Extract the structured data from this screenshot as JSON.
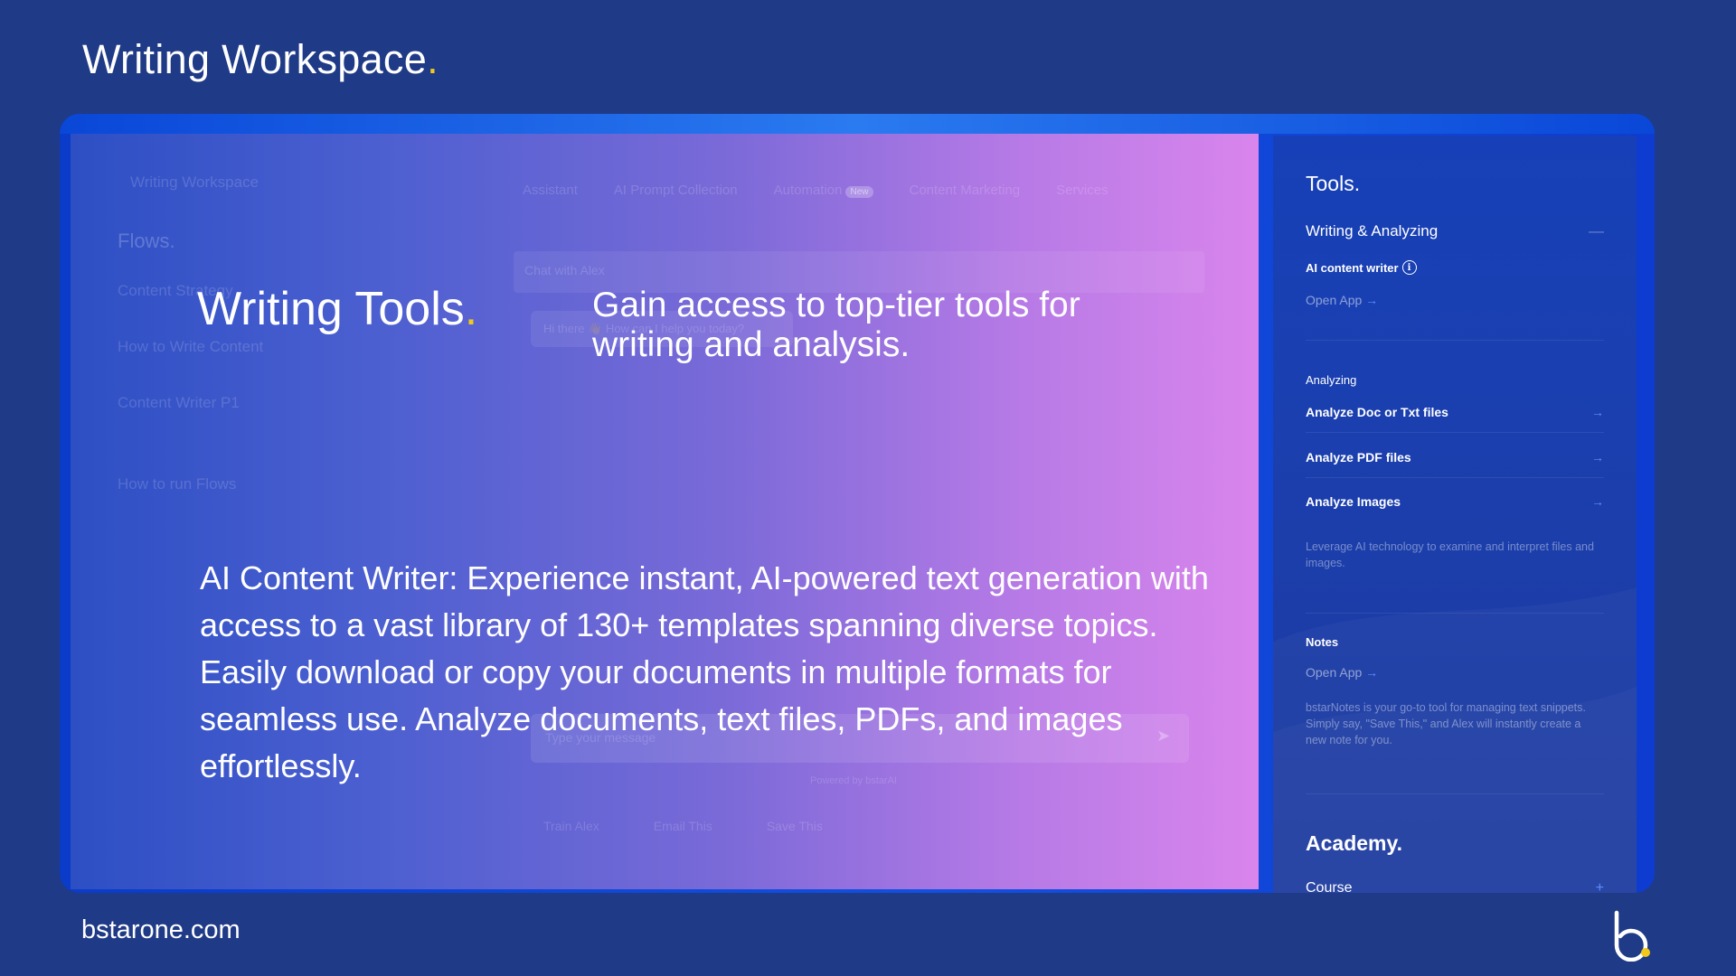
{
  "page": {
    "title": "Writing Workspace",
    "title_dot": ".",
    "footer_url": "bstarone.com",
    "accent_color": "#f2c919",
    "background_color": "#1f3a86"
  },
  "background_app": {
    "workspace_label": "Writing Workspace",
    "flows_heading": "Flows.",
    "flow_items": [
      "Content Strategy",
      "How to Write Content",
      "Content Writer P1",
      "How to run Flows"
    ],
    "tabs": [
      "Assistant",
      "AI Prompt Collection",
      "Automation",
      "Content Marketing",
      "Services"
    ],
    "new_badge": "New",
    "chat_label": "Chat with Alex",
    "greeting": "Hi there 👋 How can I help you today?",
    "input_placeholder": "Type your message",
    "powered_by": "Powered by bstarAI",
    "actions": [
      "Train Alex",
      "Email This",
      "Save This"
    ]
  },
  "overlay": {
    "title": "Writing Tools",
    "title_dot": ".",
    "tagline": "Gain access to top-tier tools for writing and analysis.",
    "description": "AI Content Writer: Experience instant, AI-powered text generation with access to a vast library of 130+ templates spanning diverse topics. Easily download or copy your documents in multiple formats for seamless use. Analyze documents, text files, PDFs, and images effortlessly."
  },
  "sidebar": {
    "heading": "Tools.",
    "writing_section": "Writing & Analyzing",
    "collapse_symbol": "—",
    "ai_writer_label": "AI content writer",
    "open_app": "Open App",
    "analyzing_label": "Analyzing",
    "analyze_items": [
      "Analyze Doc or Txt files",
      "Analyze PDF files",
      "Analyze Images"
    ],
    "analyze_desc": "Leverage AI technology to examine and interpret files and images.",
    "notes_label": "Notes",
    "notes_desc": "bstarNotes is your go-to tool for managing text snippets. Simply say, \"Save This,\" and Alex will instantly create a new note for you.",
    "academy_heading": "Academy.",
    "course_label": "Course",
    "expand_symbol": "+"
  }
}
